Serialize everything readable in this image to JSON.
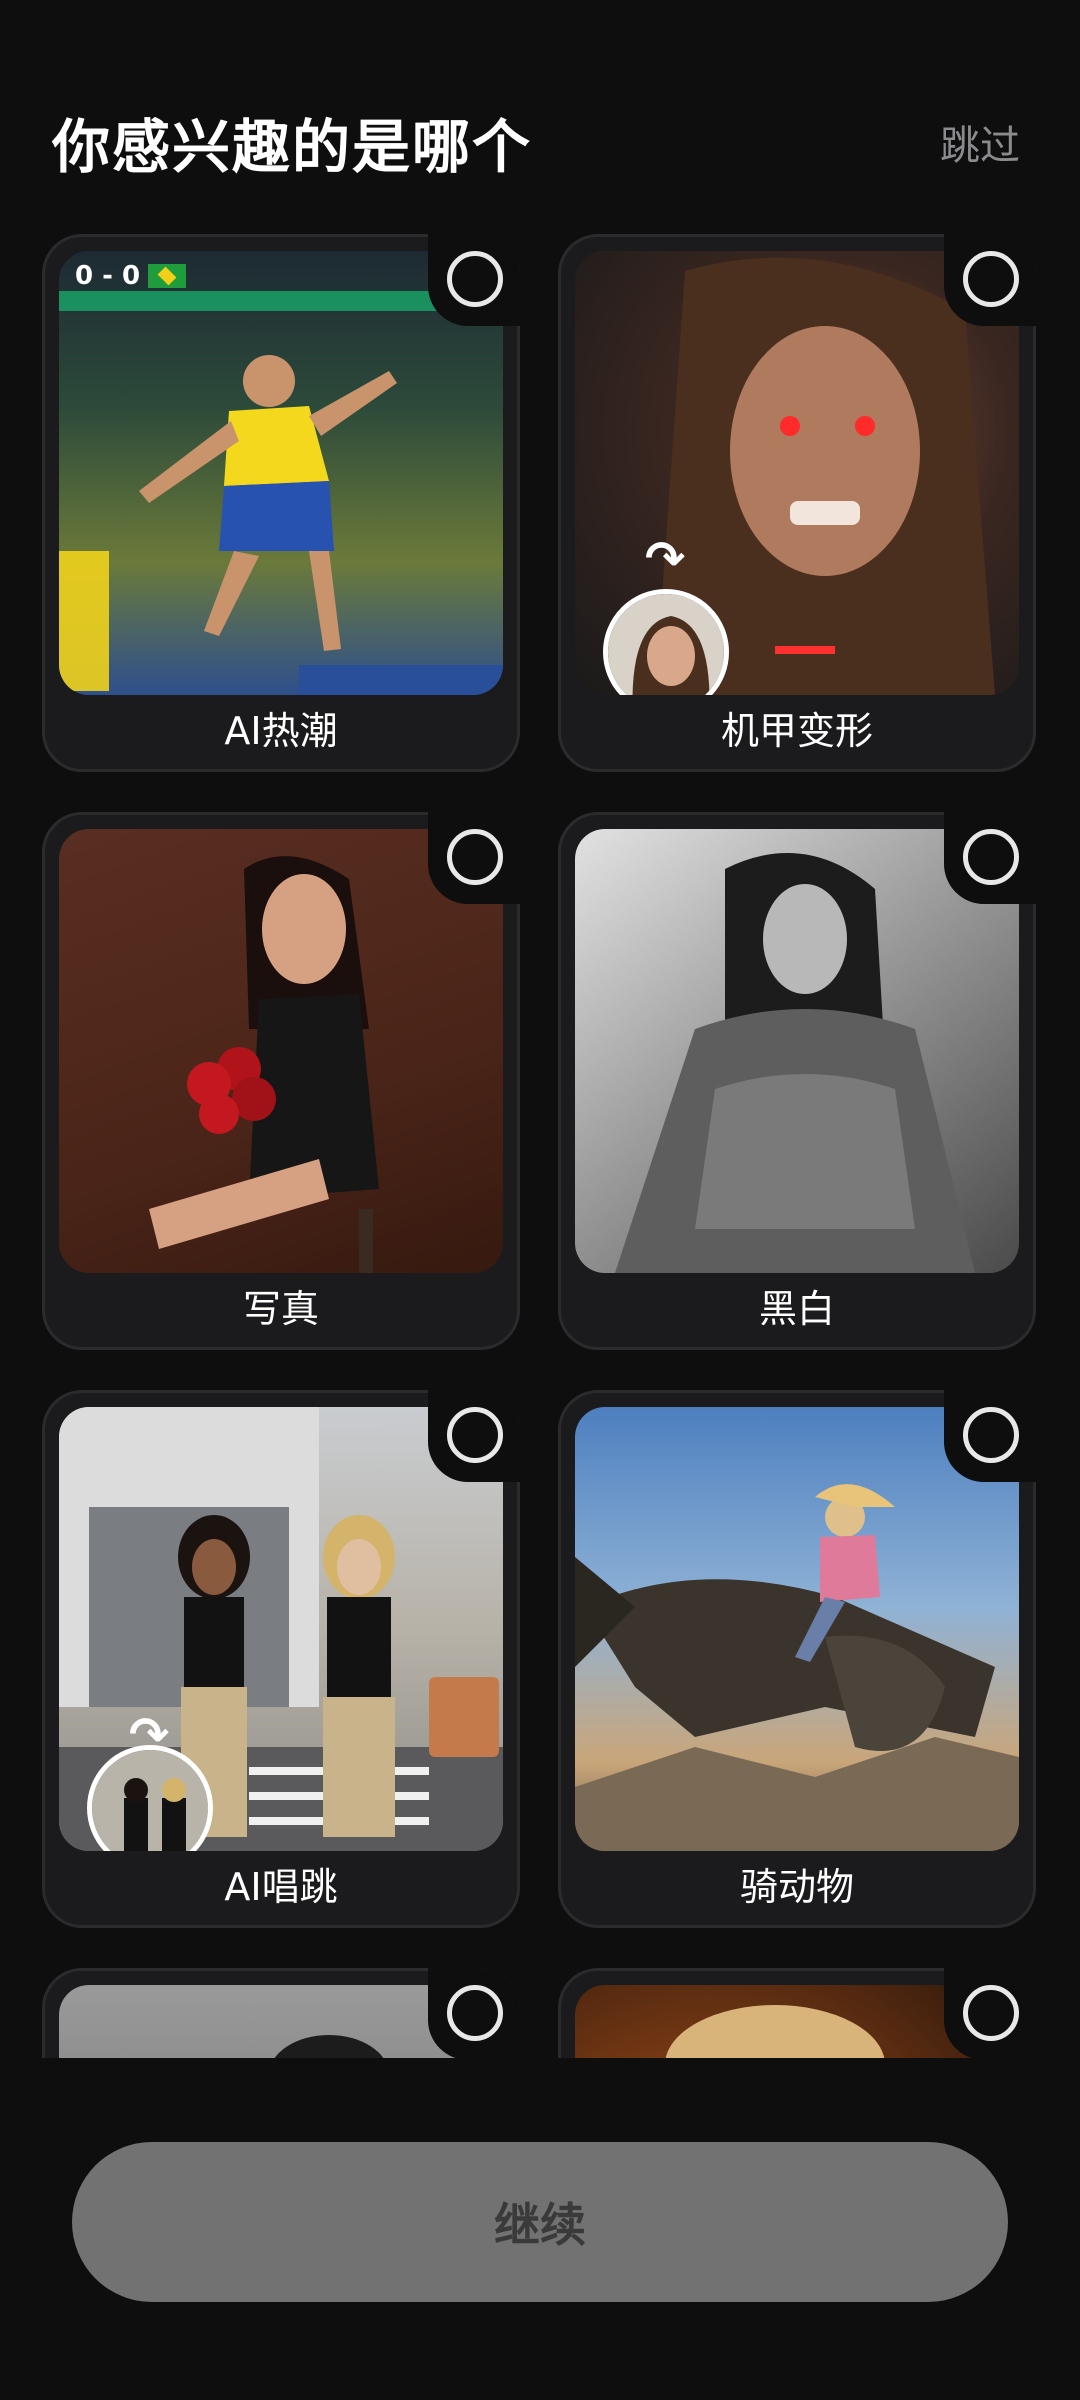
{
  "header": {
    "title": "你感兴趣的是哪个",
    "skip_label": "跳过"
  },
  "cards": [
    {
      "label": "AI热潮",
      "thumbnail": "football-player-image",
      "score": "0 - 0",
      "selected": false
    },
    {
      "label": "机甲变形",
      "thumbnail": "angry-woman-transform-image",
      "selected": false
    },
    {
      "label": "写真",
      "thumbnail": "woman-with-roses-image",
      "selected": false
    },
    {
      "label": "黑白",
      "thumbnail": "black-white-portrait-image",
      "selected": false
    },
    {
      "label": "AI唱跳",
      "thumbnail": "two-women-street-image",
      "selected": false
    },
    {
      "label": "骑动物",
      "thumbnail": "girl-riding-dragon-image",
      "selected": false
    },
    {
      "label": "",
      "thumbnail": "partial-grey-image",
      "selected": false
    },
    {
      "label": "",
      "thumbnail": "partial-warm-image",
      "selected": false
    }
  ],
  "footer": {
    "continue_label": "继续"
  },
  "colors": {
    "background": "#0e0e0f",
    "card": "#1b1b1d",
    "button": "#727272",
    "skip_text": "#8b8b8e"
  }
}
